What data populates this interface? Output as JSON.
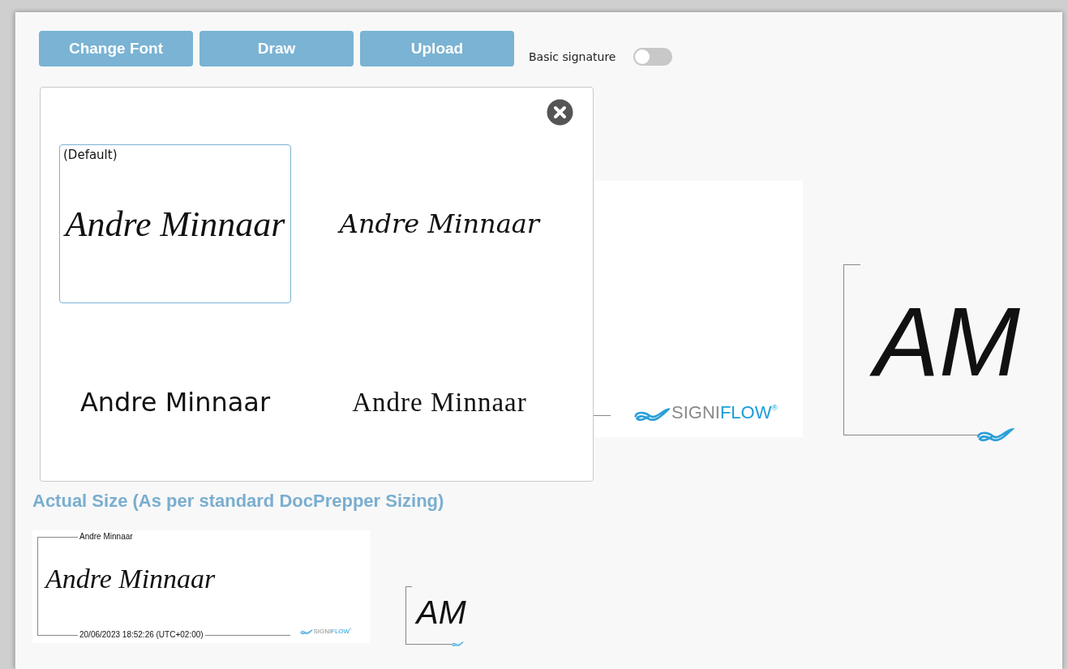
{
  "toolbar": {
    "buttons": [
      {
        "label": "Change Font"
      },
      {
        "label": "Draw"
      },
      {
        "label": "Upload"
      }
    ],
    "toggle": {
      "label": "Basic signature",
      "on": false
    }
  },
  "font_dialog": {
    "options": [
      {
        "label": "(Default)",
        "text": "Andre Minnaar",
        "kind": "brush",
        "selected": true
      },
      {
        "text": "Andre Minnaar",
        "kind": "script",
        "selected": false
      },
      {
        "text": "Andre Minnaar",
        "kind": "sans",
        "selected": false
      },
      {
        "text": "Andre Minnaar",
        "kind": "fancy",
        "selected": false
      }
    ]
  },
  "preview": {
    "signature_card": {
      "logo": {
        "grey": "SIGNI",
        "blue": "FLOW",
        "mark": "®"
      }
    },
    "initials": "AM"
  },
  "actual_size": {
    "heading": "Actual Size (As per standard DocPrepper Sizing)",
    "signature_card": {
      "name": "Andre Minnaar",
      "signature": "Andre Minnaar",
      "timestamp": "20/06/2023 18:52:26 (UTC+02:00)",
      "logo": {
        "grey": "SIGNI",
        "blue": "FLOW",
        "mark": "®"
      }
    },
    "initials": "AM"
  }
}
